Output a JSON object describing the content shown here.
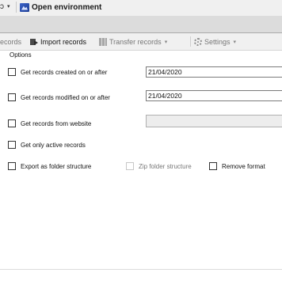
{
  "toolbar": {
    "left_fragment": "ɔ",
    "dropdown_arrow": "▾",
    "environment_label": "Open environment"
  },
  "ribbon": {
    "records_fragment": "ecords",
    "import_label": "Import records",
    "transfer_label": "Transfer records",
    "transfer_arrow": "▾",
    "settings_label": "Settings",
    "settings_arrow": "▾"
  },
  "options": {
    "title": "Options",
    "created_after_label": "Get records created on or after",
    "created_after_value": "21/04/2020",
    "modified_after_label": "Get records modified on or after",
    "modified_after_value": "21/04/2020",
    "from_website_label": "Get records from website",
    "from_website_value": "",
    "only_active_label": "Get only active records",
    "export_folder_label": "Export as folder structure",
    "zip_folder_label": "Zip folder structure",
    "remove_format_label": "Remove format"
  }
}
